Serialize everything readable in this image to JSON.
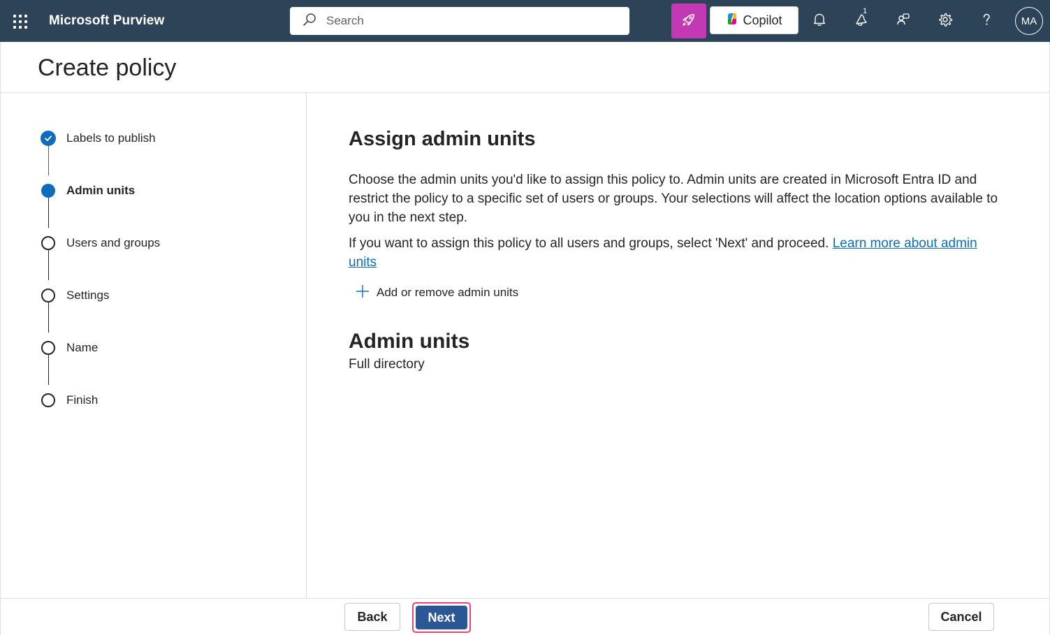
{
  "app": {
    "name": "Microsoft Purview"
  },
  "topbar": {
    "search_placeholder": "Search",
    "copilot_label": "Copilot",
    "whats_new_badge": "1",
    "avatar_initials": "MA",
    "icons": [
      "app-launcher-icon",
      "search-icon",
      "rocket-icon",
      "copilot-logo-icon",
      "bell-icon",
      "whats-new-icon",
      "people-icon",
      "gear-icon",
      "help-icon"
    ]
  },
  "page": {
    "title": "Create policy"
  },
  "steps": [
    {
      "label": "Labels to publish",
      "state": "done"
    },
    {
      "label": "Admin units",
      "state": "current"
    },
    {
      "label": "Users and groups",
      "state": "todo"
    },
    {
      "label": "Settings",
      "state": "todo"
    },
    {
      "label": "Name",
      "state": "todo"
    },
    {
      "label": "Finish",
      "state": "todo"
    }
  ],
  "main": {
    "heading": "Assign admin units",
    "description": "Choose the admin units you'd like to assign this policy to. Admin units are created in Microsoft Entra ID and restrict the policy to a specific set of users or groups. Your selections will affect the location options available to you in the next step.",
    "description2_text": "If you want to assign this policy to all users and groups, select 'Next' and proceed. ",
    "description2_link": "Learn more about admin units",
    "add_remove_label": "Add or remove admin units",
    "admin_units_heading": "Admin units",
    "admin_units_value": "Full directory"
  },
  "footer": {
    "back_label": "Back",
    "next_label": "Next",
    "cancel_label": "Cancel"
  },
  "colors": {
    "topbar_bg": "#2d4358",
    "accent": "#0f6cbd",
    "rocket_bg": "#c239b3",
    "next_bg": "#2b5796",
    "next_highlight": "#e8437a"
  }
}
